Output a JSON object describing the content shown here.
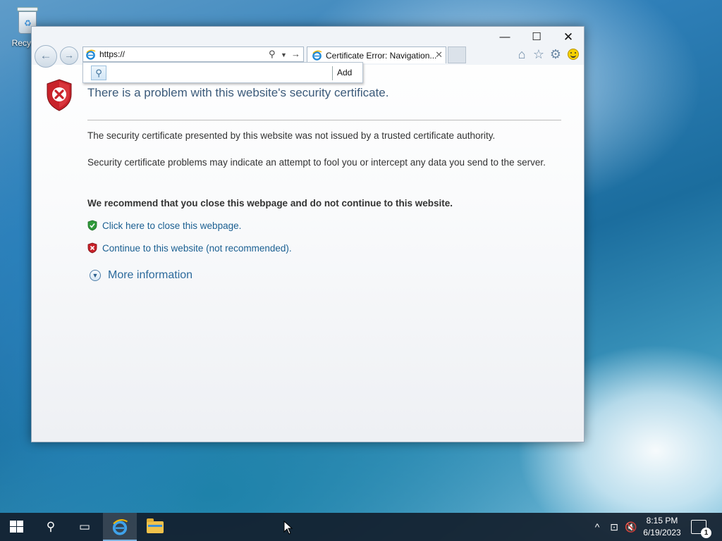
{
  "desktop": {
    "recycle_bin_label": "Recycle"
  },
  "browser": {
    "address_url": "https://",
    "tab_title": "Certificate Error: Navigation...",
    "search_add_label": "Add",
    "window_controls": {
      "minimize": "—",
      "maximize": "☐",
      "close": "✕"
    },
    "toolbar_icons": [
      "home-icon",
      "favorites-star-icon",
      "settings-gear-icon",
      "feedback-smiley-icon"
    ]
  },
  "page": {
    "heading": "There is a problem with this website's security certificate.",
    "para1": "The security certificate presented by this website was not issued by a trusted certificate authority.",
    "para2": "Security certificate problems may indicate an attempt to fool you or intercept any data you send to the server.",
    "recommendation": "We recommend that you close this webpage and do not continue to this website.",
    "close_link": "Click here to close this webpage.",
    "continue_link": "Continue to this website (not recommended).",
    "more_info": "More information"
  },
  "taskbar": {
    "clock_time": "8:15 PM",
    "clock_date": "6/19/2023",
    "notification_count": "1"
  },
  "colors": {
    "heading": "#3b5a7a",
    "link": "#1a5f91",
    "danger": "#c8222a",
    "safe": "#2f9a3a",
    "taskbar": "#121e2c"
  }
}
